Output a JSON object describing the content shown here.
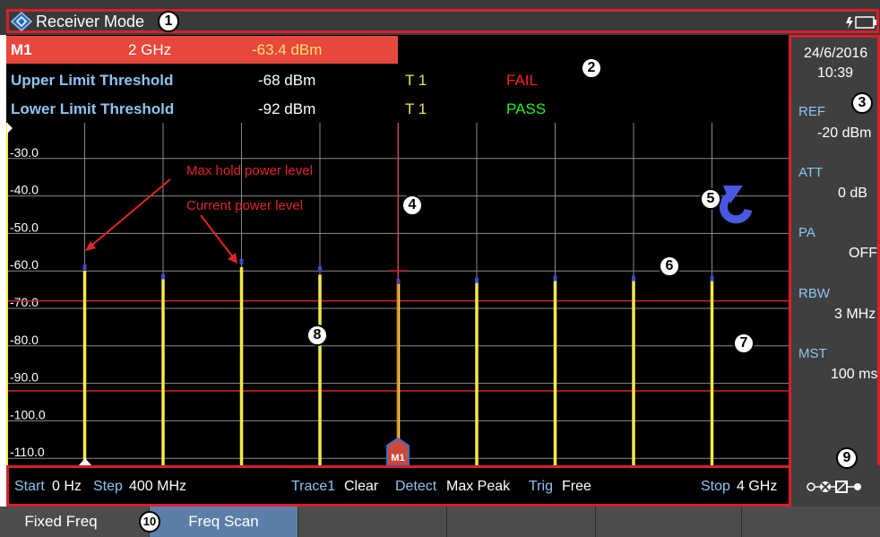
{
  "title_bar": {
    "mode_title": "Receiver Mode"
  },
  "marker": {
    "label": "M1",
    "frequency": "2 GHz",
    "level": "-63.4 dBm"
  },
  "limits": [
    {
      "label": "Upper Limit Threshold",
      "value": "-68 dBm",
      "trace": "T 1",
      "result": "FAIL"
    },
    {
      "label": "Lower Limit Threshold",
      "value": "-92 dBm",
      "trace": "T 1",
      "result": "PASS"
    }
  ],
  "side_panel": {
    "date": "24/6/2016",
    "time": "10:39",
    "ref_label": "REF",
    "ref_value": "-20 dBm",
    "att_label": "ATT",
    "att_value": "0 dB",
    "pa_label": "PA",
    "pa_value": "OFF",
    "rbw_label": "RBW",
    "rbw_value": "3 MHz",
    "mst_label": "MST",
    "mst_value": "100 ms"
  },
  "plot": {
    "y_ticks": [
      "-30.0",
      "-40.0",
      "-50.0",
      "-60.0",
      "-70.0",
      "-80.0",
      "-90.0",
      "-100.0",
      "-110.0"
    ],
    "annotations": {
      "max_hold": "Max hold power level",
      "current": "Current power level"
    },
    "marker_flag": "M1"
  },
  "chart_data": {
    "type": "bar",
    "x": [
      0,
      400,
      800,
      1200,
      1600,
      2000,
      2400,
      2800,
      3200,
      3600,
      4000
    ],
    "x_unit": "MHz",
    "series": [
      {
        "name": "Current power level",
        "values": [
          null,
          -60,
          -62,
          -59,
          -61,
          -63.4,
          -63,
          -62.5,
          -62,
          -62.5,
          -62
        ]
      },
      {
        "name": "Max hold power level",
        "values": [
          null,
          -59,
          -61.5,
          -57.5,
          -59.5,
          -62.8,
          -62.5,
          -62,
          -62,
          -62,
          -62
        ]
      }
    ],
    "ylim": [
      -120,
      -20
    ],
    "grid": true,
    "upper_limit": -68,
    "lower_limit": -92
  },
  "status_bar": {
    "start_label": "Start",
    "start_value": "0 Hz",
    "step_label": "Step",
    "step_value": "400 MHz",
    "trace_label": "Trace1",
    "trace_value": "Clear",
    "detect_label": "Detect",
    "detect_value": "Max Peak",
    "trig_label": "Trig",
    "trig_value": "Free",
    "stop_label": "Stop",
    "stop_value": "4 GHz"
  },
  "softkeys": [
    "Fixed Freq",
    "Freq Scan",
    "",
    "",
    "",
    ""
  ],
  "callouts": [
    "1",
    "2",
    "3",
    "4",
    "5",
    "6",
    "7",
    "8",
    "9",
    "10"
  ],
  "colors": {
    "trace": "#f5e84a",
    "limit_line": "#d8202a",
    "accent": "#d8202a",
    "marker_bar": "#e8473d",
    "refresh_icon": "#4a5ae0"
  }
}
